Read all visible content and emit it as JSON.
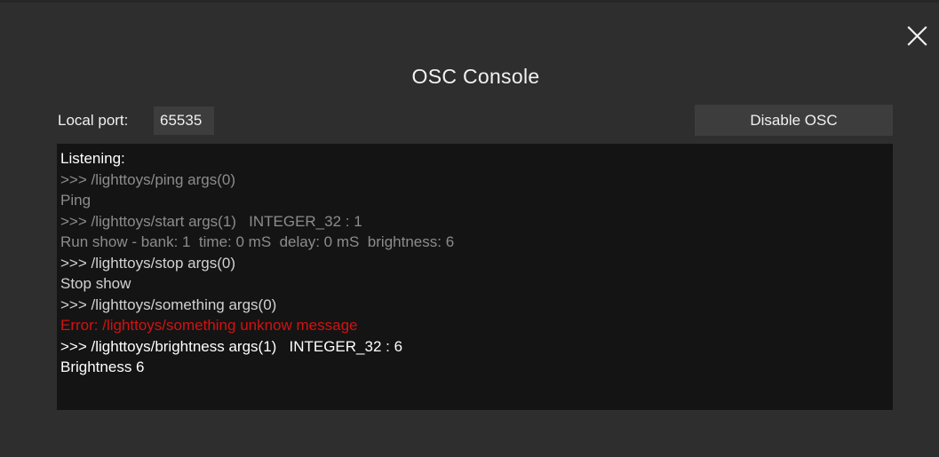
{
  "dialog": {
    "title": "OSC Console",
    "port_label": "Local port:",
    "port_value": "65535",
    "disable_label": "Disable OSC"
  },
  "colors": {
    "background": "#2e2e2e",
    "log_background": "#141414",
    "control_background": "#3d3d3d",
    "text_bright": "#ffffff",
    "text_normal": "#d2d2d2",
    "text_dim": "#8c8c8c",
    "text_error": "#d11313"
  },
  "log": {
    "lines": [
      {
        "text": "Listening:",
        "style": "bright"
      },
      {
        "text": ">>> /lighttoys/ping args(0)",
        "style": "dim"
      },
      {
        "text": "Ping",
        "style": "dim"
      },
      {
        "text": ">>> /lighttoys/start args(1)   INTEGER_32 : 1",
        "style": "dim"
      },
      {
        "text": "Run show - bank: 1  time: 0 mS  delay: 0 mS  brightness: 6",
        "style": "dim"
      },
      {
        "text": ">>> /lighttoys/stop args(0)",
        "style": "normal"
      },
      {
        "text": "Stop show",
        "style": "normal"
      },
      {
        "text": ">>> /lighttoys/something args(0)",
        "style": "normal"
      },
      {
        "text": "Error: /lighttoys/something unknow message",
        "style": "error"
      },
      {
        "text": ">>> /lighttoys/brightness args(1)   INTEGER_32 : 6",
        "style": "bright"
      },
      {
        "text": "Brightness 6",
        "style": "bright"
      }
    ]
  },
  "icons": {
    "close": "close-icon"
  }
}
